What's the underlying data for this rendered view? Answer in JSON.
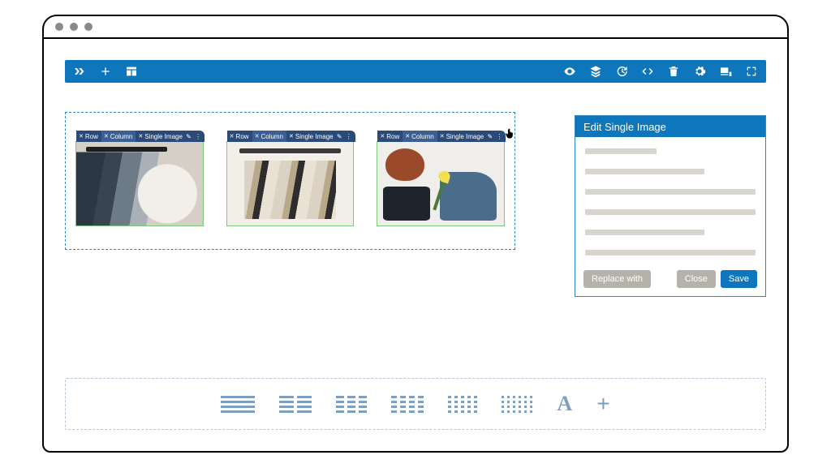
{
  "toolbar_left": [
    "app-logo",
    "add",
    "library"
  ],
  "toolbar_right": [
    "preview",
    "layers",
    "history",
    "code",
    "trash",
    "settings",
    "responsive",
    "fullscreen"
  ],
  "breadcrumb": {
    "row": "Row",
    "column": "Column",
    "element": "Single Image"
  },
  "panel": {
    "title": "Edit Single Image",
    "buttons": {
      "replace": "Replace with",
      "close": "Close",
      "save": "Save"
    }
  },
  "inserter": {
    "text_option": "A",
    "add": "+"
  }
}
